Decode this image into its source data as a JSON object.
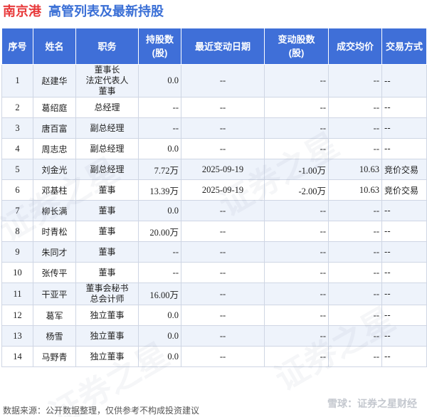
{
  "header": {
    "company": "南京港",
    "subject": "高管列表及最新持股"
  },
  "table": {
    "columns": [
      "序号",
      "姓名",
      "职务",
      "持股数\n(股)",
      "最近变动日期",
      "变动股数\n(股)",
      "成交均价",
      "交易方式"
    ],
    "rows": [
      {
        "no": "1",
        "name": "赵建华",
        "position": "董事长\n法定代表人\n董事",
        "shares": "0.0",
        "date": "--",
        "change": "--",
        "price": "--",
        "method": "--"
      },
      {
        "no": "2",
        "name": "葛绍庭",
        "position": "总经理",
        "shares": "--",
        "date": "--",
        "change": "--",
        "price": "--",
        "method": "--"
      },
      {
        "no": "3",
        "name": "唐百富",
        "position": "副总经理",
        "shares": "--",
        "date": "--",
        "change": "--",
        "price": "--",
        "method": "--"
      },
      {
        "no": "4",
        "name": "周志忠",
        "position": "副总经理",
        "shares": "0.0",
        "date": "--",
        "change": "--",
        "price": "--",
        "method": "--"
      },
      {
        "no": "5",
        "name": "刘金光",
        "position": "副总经理",
        "shares": "7.72万",
        "date": "2025-09-19",
        "change": "-1.00万",
        "price": "10.63",
        "method": "竞价交易"
      },
      {
        "no": "6",
        "name": "邓基柱",
        "position": "董事",
        "shares": "13.39万",
        "date": "2025-09-19",
        "change": "-2.00万",
        "price": "10.63",
        "method": "竞价交易"
      },
      {
        "no": "7",
        "name": "柳长满",
        "position": "董事",
        "shares": "0.0",
        "date": "--",
        "change": "--",
        "price": "--",
        "method": "--"
      },
      {
        "no": "8",
        "name": "时青松",
        "position": "董事",
        "shares": "20.00万",
        "date": "--",
        "change": "--",
        "price": "--",
        "method": "--"
      },
      {
        "no": "9",
        "name": "朱同才",
        "position": "董事",
        "shares": "--",
        "date": "--",
        "change": "--",
        "price": "--",
        "method": "--"
      },
      {
        "no": "10",
        "name": "张传平",
        "position": "董事",
        "shares": "--",
        "date": "--",
        "change": "--",
        "price": "--",
        "method": "--"
      },
      {
        "no": "11",
        "name": "干亚平",
        "position": "董事会秘书\n总会计师",
        "shares": "16.00万",
        "date": "--",
        "change": "--",
        "price": "--",
        "method": "--"
      },
      {
        "no": "12",
        "name": "葛军",
        "position": "独立董事",
        "shares": "0.0",
        "date": "--",
        "change": "--",
        "price": "--",
        "method": "--"
      },
      {
        "no": "13",
        "name": "杨雪",
        "position": "独立董事",
        "shares": "0.0",
        "date": "--",
        "change": "--",
        "price": "--",
        "method": "--"
      },
      {
        "no": "14",
        "name": "马野青",
        "position": "独立董事",
        "shares": "0.0",
        "date": "--",
        "change": "--",
        "price": "--",
        "method": "--"
      }
    ]
  },
  "footer": {
    "source": "数据来源：公开数据整理，仅供参考不构成投资建议"
  },
  "brand": {
    "logo_text": "雪球：证券之星财经",
    "watermark_text": "证券之星"
  },
  "colors": {
    "header_bg": "#3f6fd8",
    "company_title": "#e8393a",
    "subject_title": "#3a6fd6",
    "stripe": "#eef3fb",
    "negative_change": "#11a84a"
  }
}
